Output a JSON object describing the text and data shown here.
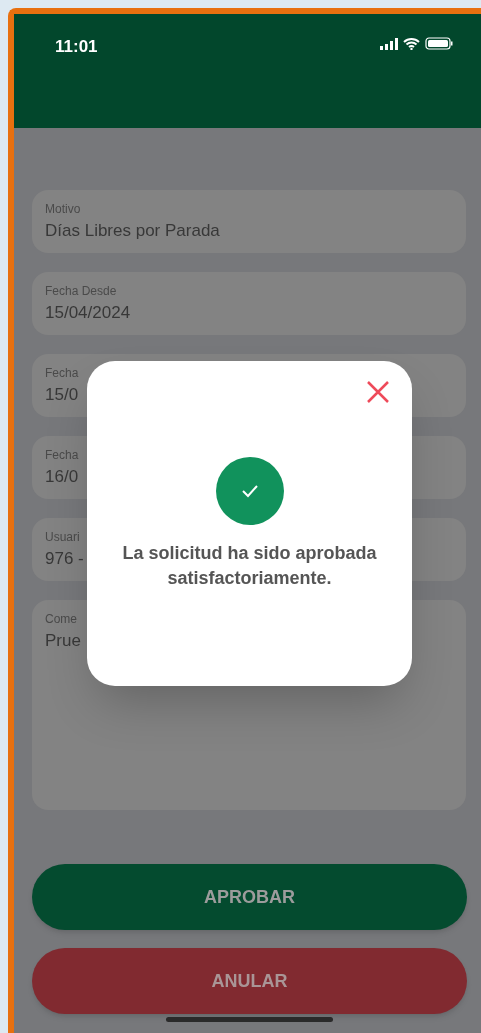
{
  "status_bar": {
    "time": "11:01"
  },
  "fields": [
    {
      "label": "Motivo",
      "value": "Días Libres por Parada",
      "kind": "single"
    },
    {
      "label": "Fecha Desde",
      "value": "15/04/2024",
      "kind": "single"
    },
    {
      "label": "Fecha",
      "value": "15/0",
      "kind": "single"
    },
    {
      "label": "Fecha",
      "value": "16/0",
      "kind": "single"
    },
    {
      "label": "Usuari",
      "value": "976 -",
      "kind": "single"
    },
    {
      "label": "Come",
      "value": "Prue",
      "kind": "multiline"
    }
  ],
  "dialog": {
    "message": "La solicitud ha sido aprobada satisfactoriamente."
  },
  "buttons": [
    {
      "label": "APROBAR",
      "kind": "approve"
    },
    {
      "label": "ANULAR",
      "kind": "cancel"
    }
  ]
}
